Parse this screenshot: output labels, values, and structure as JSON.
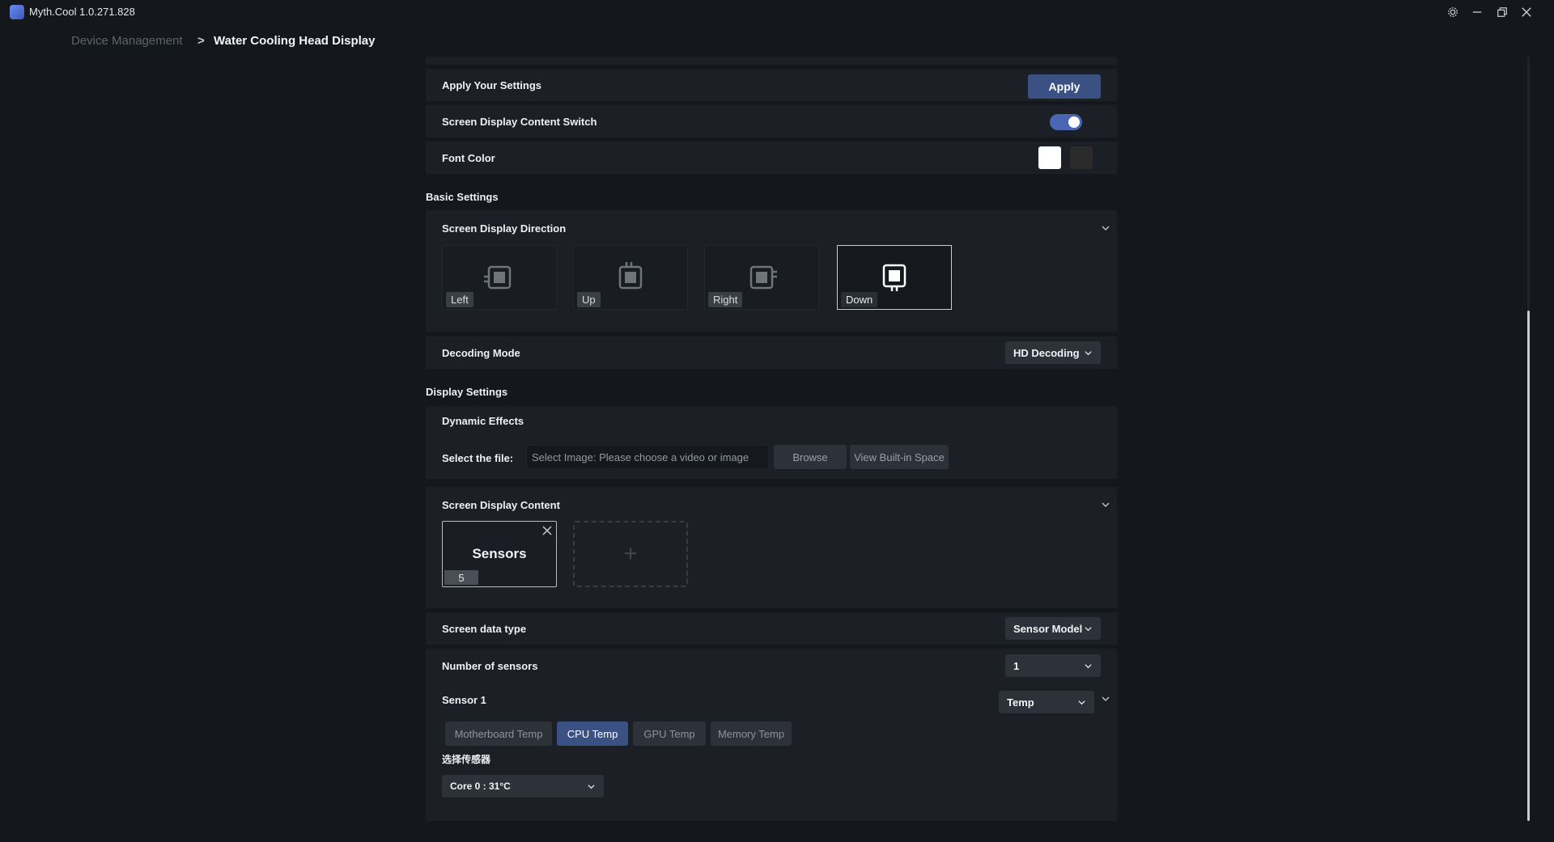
{
  "app": {
    "title": "Myth.Cool 1.0.271.828"
  },
  "breadcrumb": {
    "parent": "Device Management",
    "separator": ">",
    "current": "Water Cooling Head Display"
  },
  "apply_row": {
    "label": "Apply Your Settings",
    "button": "Apply"
  },
  "switch_row": {
    "label": "Screen Display Content Switch",
    "enabled": true
  },
  "font_color_row": {
    "label": "Font Color",
    "options": [
      "#ffffff",
      "#2b2b2b"
    ],
    "selected": "#ffffff"
  },
  "basic_settings": {
    "title": "Basic Settings",
    "direction": {
      "label": "Screen Display Direction",
      "options": [
        "Left",
        "Up",
        "Right",
        "Down"
      ],
      "selected": "Down"
    },
    "decoding": {
      "label": "Decoding Mode",
      "value": "HD Decoding"
    }
  },
  "display_settings": {
    "title": "Display Settings",
    "dynamic_effects": {
      "label": "Dynamic Effects",
      "file_label": "Select the file:",
      "file_placeholder": "Select Image: Please choose a video or image",
      "browse": "Browse",
      "view_builtin": "View Built-in Space"
    },
    "screen_content": {
      "label": "Screen Display Content",
      "card_title": "Sensors",
      "card_badge": "5",
      "add_symbol": "+"
    },
    "data_type": {
      "label": "Screen data type",
      "value": "Sensor Model"
    },
    "num_sensors": {
      "label": "Number of sensors",
      "value": "1"
    },
    "sensor1": {
      "label": "Sensor 1",
      "type_value": "Temp",
      "chips": [
        "Motherboard Temp",
        "CPU Temp",
        "GPU Temp",
        "Memory Temp"
      ],
      "selected_chip": "CPU Temp",
      "select_label": "选择传感器",
      "select_value": "Core 0 : 31°C"
    }
  },
  "colors": {
    "accent": "#3b5184",
    "toggle": "#4966b3",
    "panel": "#1c1f26",
    "background": "#14171c"
  }
}
